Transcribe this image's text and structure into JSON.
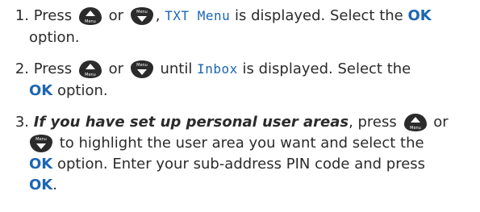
{
  "steps": [
    {
      "number": "1.",
      "line1": {
        "press": "Press",
        "or": "or",
        "comma": ",",
        "display_text": "TXT Menu",
        "after_display": "is displayed. Select the",
        "ok": "OK"
      },
      "line2": {
        "text": "option."
      }
    },
    {
      "number": "2.",
      "line1": {
        "press": "Press",
        "or": "or",
        "until": "until",
        "display_text": "Inbox",
        "after_display": "is displayed. Select the"
      },
      "line2": {
        "ok": "OK",
        "text": "option."
      }
    },
    {
      "number": "3.",
      "line1": {
        "emphasis": "If you have set up personal user areas",
        "after": ", press",
        "or": "or"
      },
      "line2": {
        "text": "to highlight the user area you want and select the"
      },
      "line3": {
        "ok": "OK",
        "text": "option. Enter your sub-address PIN code and press"
      },
      "line4": {
        "ok": "OK",
        "period": "."
      }
    }
  ],
  "icons": {
    "up_key_label": "Menu",
    "down_key_label": "Menu",
    "key_color": "#2b2b2b"
  },
  "colors": {
    "accent": "#1c66b2",
    "text": "#2b2b2b"
  }
}
